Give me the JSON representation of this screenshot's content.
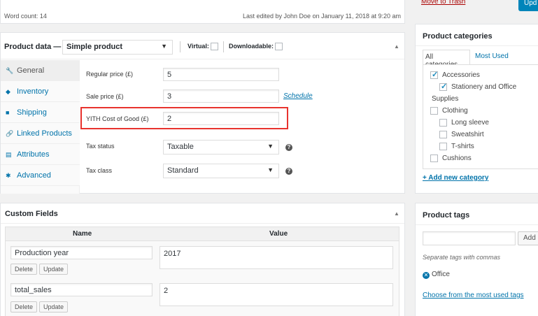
{
  "top": {
    "word_count": "Word count: 14",
    "last_edited": "Last edited by John Doe on January 11, 2018 at 9:20 am",
    "move_to_trash": "Move to Trash",
    "update_button": "Upd"
  },
  "product_data": {
    "title": "Product data —",
    "type_value": "Simple product",
    "virtual_label": "Virtual:",
    "downloadable_label": "Downloadable:",
    "tabs": [
      {
        "label": "General",
        "icon": "wrench-icon",
        "glyph": "🔧"
      },
      {
        "label": "Inventory",
        "icon": "tag-icon",
        "glyph": "◆"
      },
      {
        "label": "Shipping",
        "icon": "truck-icon",
        "glyph": "■"
      },
      {
        "label": "Linked Products",
        "icon": "link-icon",
        "glyph": "🔗"
      },
      {
        "label": "Attributes",
        "icon": "list-icon",
        "glyph": "▤"
      },
      {
        "label": "Advanced",
        "icon": "gear-icon",
        "glyph": "✱"
      }
    ],
    "regular_price_label": "Regular price (£)",
    "regular_price_value": "5",
    "sale_price_label": "Sale price (£)",
    "sale_price_value": "3",
    "schedule_link": "Schedule",
    "cost_label": "YITH Cost of Good (£)",
    "cost_value": "2",
    "tax_status_label": "Tax status",
    "tax_status_value": "Taxable",
    "tax_class_label": "Tax class",
    "tax_class_value": "Standard",
    "highlight_color": "#e8332e"
  },
  "custom_fields": {
    "title": "Custom Fields",
    "col_name": "Name",
    "col_value": "Value",
    "rows": [
      {
        "name": "Production year",
        "value": "2017",
        "delete": "Delete",
        "update": "Update"
      },
      {
        "name": "total_sales",
        "value": "2",
        "delete": "Delete",
        "update": "Update"
      }
    ]
  },
  "categories": {
    "title": "Product categories",
    "tab_all": "All categories",
    "tab_used": "Most Used",
    "items": [
      {
        "label": "Accessories",
        "checked": true
      },
      {
        "label": "Stationery and Office",
        "checked": true
      },
      {
        "label": "Supplies",
        "checked": false
      },
      {
        "label": "Clothing",
        "checked": false
      },
      {
        "label": "Long sleeve",
        "checked": false
      },
      {
        "label": "Sweatshirt",
        "checked": false
      },
      {
        "label": "T-shirts",
        "checked": false
      },
      {
        "label": "Cushions",
        "checked": false
      }
    ],
    "add_new": "+ Add new category"
  },
  "tags": {
    "title": "Product tags",
    "add_button": "Add",
    "hint": "Separate tags with commas",
    "tag": "Office",
    "choose_link": "Choose from the most used tags"
  }
}
